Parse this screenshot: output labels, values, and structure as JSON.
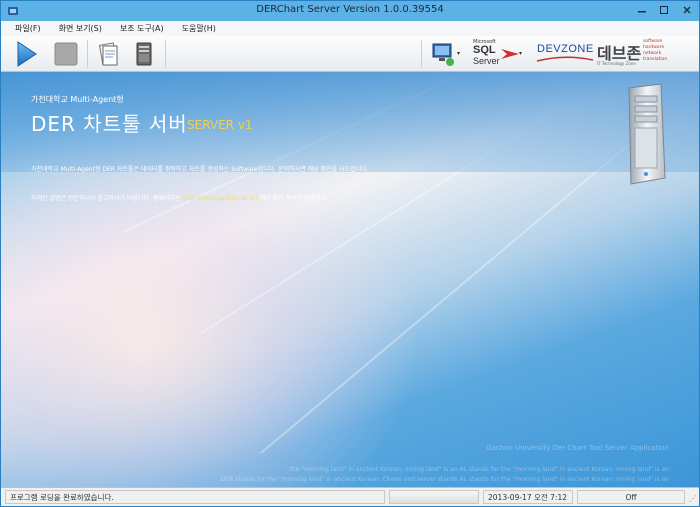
{
  "window": {
    "title": "DERChart Server Version 1.0.0.39554"
  },
  "menu": {
    "items": [
      "파일(F)",
      "화면 보기(S)",
      "보조 도구(A)",
      "도움말(H)"
    ]
  },
  "toolbar": {
    "sql_label_top": "Microsoft",
    "sql_label": "SQL",
    "sql_label2": "Server",
    "devzone_label": "DEVZONE",
    "devzone_korean": "데브존",
    "devzone_tag1": "software",
    "devzone_tag2": "hardware",
    "devzone_tag3": "network",
    "devzone_tag4": "translation",
    "devzone_sub": "IT Technology Zone"
  },
  "content": {
    "subtitle": "가천대학교 Multi-Agent형",
    "title": "DER 차트툴 서버",
    "server_tag": "SERVER v1",
    "desc1": "가천대학교 Multi-Agent형 DER 차트툴은 데이터를 취득하고 차트를 생성하는 Software입니다. 문의하시면 해당 확인을 사드립니다.",
    "desc2_pre": "자세한 설명은 방문하시어 참고하시기 바랍니다. 홈페이지는",
    "desc2_link": "http://www.gachon.ac.kr/",
    "desc2_post": "에서 확인 하시기 바랍니다.",
    "footer_title": "Gachon University Der Chart Tool Server Application",
    "footer_line1": "the \"morning land\" in ancient Korean: orning land\" is an AL stands for the \"morning land\" in ancient Korean: orning land\" is an",
    "footer_line2": "DER stands for the \"morning land\" in ancient Korean: Cheon and server stands AL stands for the \"morning land\" in ancient Korean: orning land\" is an"
  },
  "statusbar": {
    "message": "프로그램 로딩을 완료하였습니다.",
    "datetime": "2013-09-17 오전 7:12",
    "state": "Off"
  }
}
